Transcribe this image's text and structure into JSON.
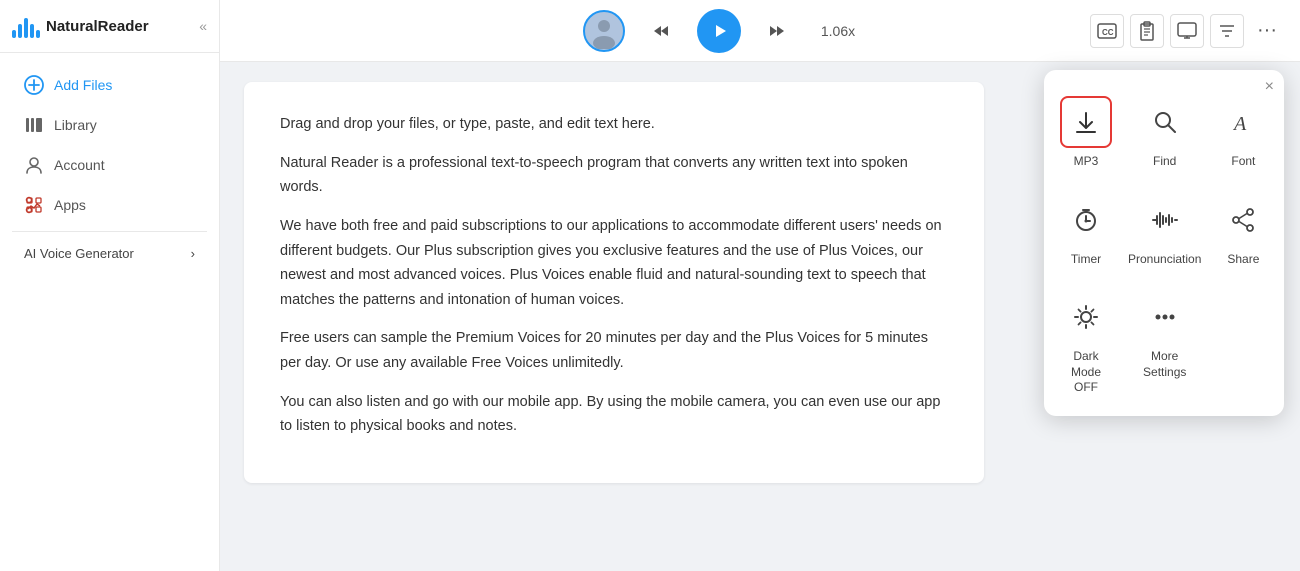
{
  "app": {
    "name": "NaturalReader",
    "logo_alt": "NaturalReader logo"
  },
  "sidebar": {
    "collapse_label": "«",
    "items": [
      {
        "id": "add-files",
        "label": "Add Files",
        "icon": "plus-circle"
      },
      {
        "id": "library",
        "label": "Library",
        "icon": "library"
      },
      {
        "id": "account",
        "label": "Account",
        "icon": "person"
      },
      {
        "id": "apps",
        "label": "Apps",
        "icon": "apps"
      }
    ],
    "sections": [
      {
        "id": "ai-voice-generator",
        "label": "AI Voice Generator",
        "chevron": "›"
      }
    ]
  },
  "topbar": {
    "speed": "1.06x",
    "buttons": {
      "rewind": "↺",
      "play": "▶",
      "forward": "↻"
    },
    "right_buttons": [
      "cc",
      "clipboard",
      "monitor",
      "filter",
      "more"
    ]
  },
  "document": {
    "paragraphs": [
      "Drag and drop your files, or type, paste, and edit text here.",
      "Natural Reader is a professional text-to-speech program that converts any written text into spoken words.",
      "We have both free and paid subscriptions to our applications to accommodate different users' needs on different budgets. Our Plus subscription gives you exclusive features and the use of Plus Voices, our newest and most advanced voices. Plus Voices enable fluid and natural-sounding text to speech that matches the patterns and intonation of human voices.",
      "Free users can sample the Premium Voices for 20 minutes per day and the Plus Voices for 5 minutes per day. Or use any available Free Voices unlimitedly.",
      "You can also listen and go with our mobile app. By using the mobile camera, you can even use our app to listen to physical books and notes."
    ]
  },
  "popup": {
    "close_label": "×",
    "items": [
      {
        "id": "mp3",
        "label": "MP3",
        "icon_type": "download",
        "highlighted": true
      },
      {
        "id": "find",
        "label": "Find",
        "icon_type": "search"
      },
      {
        "id": "font",
        "label": "Font",
        "icon_type": "font"
      },
      {
        "id": "timer",
        "label": "Timer",
        "icon_type": "timer"
      },
      {
        "id": "pronunciation",
        "label": "Pronunciation",
        "icon_type": "waveform"
      },
      {
        "id": "share",
        "label": "Share",
        "icon_type": "share"
      },
      {
        "id": "dark-mode",
        "label": "Dark Mode\nOFF",
        "icon_type": "sun"
      },
      {
        "id": "more-settings",
        "label": "More\nSettings",
        "icon_type": "dots"
      }
    ]
  },
  "colors": {
    "accent": "#2196f3",
    "highlight_red": "#e53935",
    "text_primary": "#333",
    "text_secondary": "#777"
  }
}
